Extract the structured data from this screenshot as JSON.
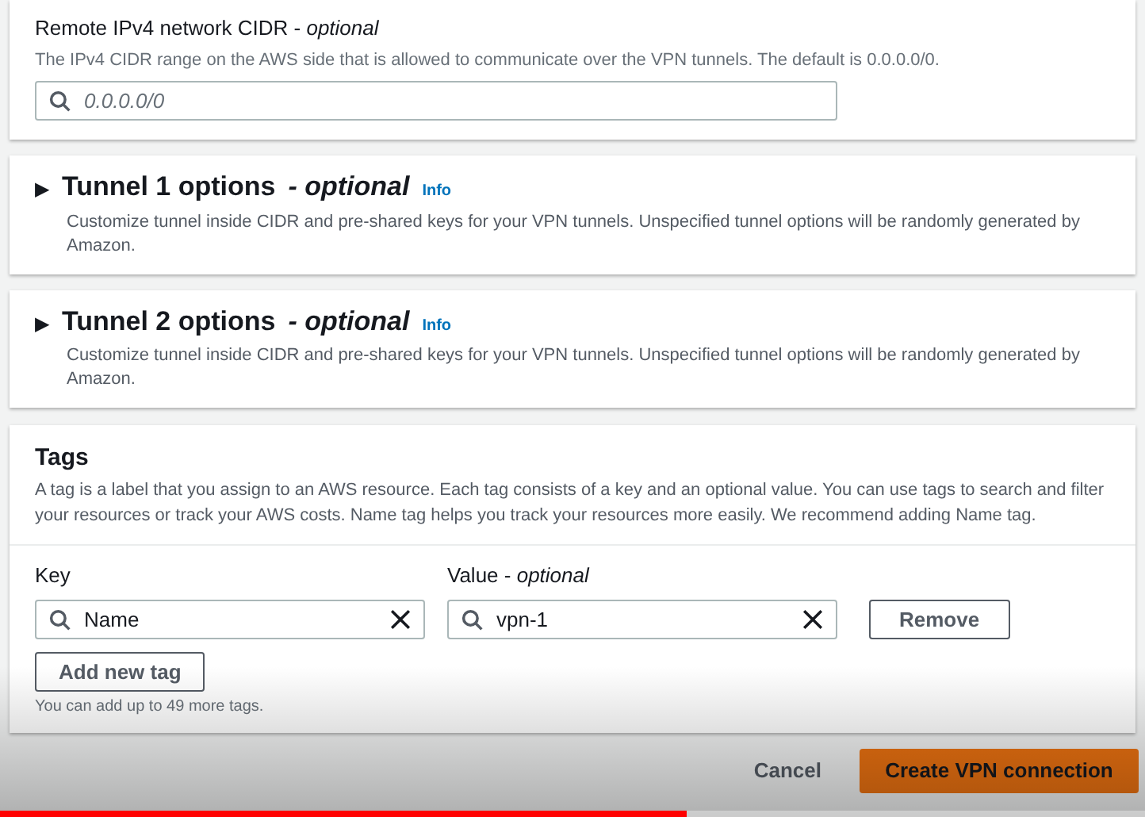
{
  "remote_cidr": {
    "label": "Remote IPv4 network CIDR - ",
    "label_optional": "optional",
    "description": "The IPv4 CIDR range on the AWS side that is allowed to communicate over the VPN tunnels. The default is 0.0.0.0/0.",
    "placeholder": "0.0.0.0/0"
  },
  "tunnel_sections": [
    {
      "marker": "▶",
      "title": "Tunnel 1 options",
      "optional": "- optional",
      "info": "Info",
      "description": "Customize tunnel inside CIDR and pre-shared keys for your VPN tunnels. Unspecified tunnel options will be randomly generated by Amazon.",
      "expanded": false
    },
    {
      "marker": "▶",
      "title": "Tunnel 2 options",
      "optional": "- optional",
      "info": "Info",
      "description": "Customize tunnel inside CIDR and pre-shared keys for your VPN tunnels. Unspecified tunnel options will be randomly generated by Amazon.",
      "expanded": false
    }
  ],
  "tags": {
    "title": "Tags",
    "description": "A tag is a label that you assign to an AWS resource. Each tag consists of a key and an optional value. You can use tags to search and filter your resources or track your AWS costs. Name tag helps you track your resources more easily. We recommend adding Name tag.",
    "key_label": "Key",
    "value_label": "Value - ",
    "value_optional": "optional",
    "rows": [
      {
        "key": "Name",
        "value": "vpn-1",
        "remove": "Remove"
      }
    ],
    "add_button": "Add new tag",
    "hint": "You can add up to 49 more tags."
  },
  "footer": {
    "cancel": "Cancel",
    "create": "Create VPN connection"
  },
  "video_progress": {
    "level": 0.6
  }
}
